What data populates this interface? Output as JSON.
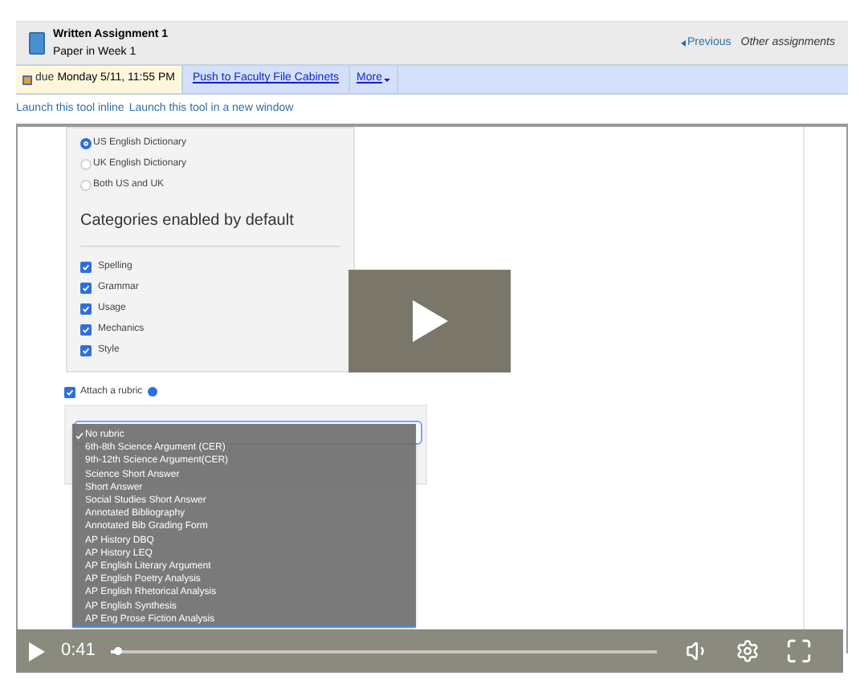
{
  "header": {
    "title": "Written Assignment 1",
    "subtitle": "Paper in Week 1",
    "previous": "Previous",
    "other": "Other assignments"
  },
  "toolbar": {
    "due_label": "due",
    "due_date": "Monday 5/11, 11:55 PM",
    "push": "Push to Faculty File Cabinets",
    "more": "More"
  },
  "launch_links": [
    "Launch this tool inline",
    "Launch this tool in a new window"
  ],
  "dictionary_options": [
    {
      "label": "US English Dictionary",
      "selected": true
    },
    {
      "label": "UK English Dictionary",
      "selected": false
    },
    {
      "label": "Both US and UK",
      "selected": false
    }
  ],
  "categories_heading": "Categories enabled by default",
  "categories": [
    {
      "label": "Spelling",
      "checked": true
    },
    {
      "label": "Grammar",
      "checked": true
    },
    {
      "label": "Usage",
      "checked": true
    },
    {
      "label": "Mechanics",
      "checked": true
    },
    {
      "label": "Style",
      "checked": true
    }
  ],
  "attach_rubric": {
    "label": "Attach a rubric",
    "checked": true
  },
  "rubric_options": [
    {
      "label": "No rubric",
      "selected": true
    },
    {
      "label": "6th-8th Science Argument (CER)",
      "selected": false
    },
    {
      "label": "9th-12th Science Argument(CER)",
      "selected": false
    },
    {
      "label": "Science Short Answer",
      "selected": false
    },
    {
      "label": "Short Answer",
      "selected": false
    },
    {
      "label": "Social Studies Short Answer",
      "selected": false
    },
    {
      "label": "Annotated Bibliography",
      "selected": false
    },
    {
      "label": "Annotated Bib Grading Form",
      "selected": false
    },
    {
      "label": "AP History DBQ",
      "selected": false
    },
    {
      "label": "AP History LEQ",
      "selected": false
    },
    {
      "label": "AP English Literary Argument",
      "selected": false
    },
    {
      "label": "AP English Poetry Analysis",
      "selected": false
    },
    {
      "label": "AP English Rhetorical Analysis",
      "selected": false
    },
    {
      "label": "AP English Synthesis",
      "selected": false
    },
    {
      "label": "AP Eng Prose Fiction Analysis",
      "selected": false
    }
  ],
  "video": {
    "time": "0:41",
    "level": 0.01
  }
}
